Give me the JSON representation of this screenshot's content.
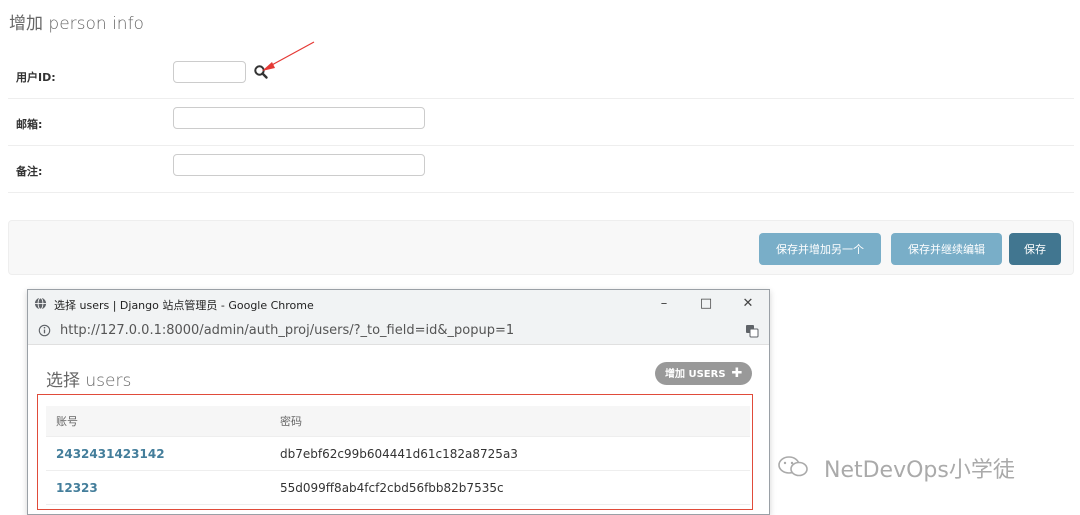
{
  "page": {
    "title": "增加 person info"
  },
  "form": {
    "user_id_label": "用户ID:",
    "email_label": "邮箱:",
    "note_label": "备注:"
  },
  "buttons": {
    "save_add_another": "保存并增加另一个",
    "save_continue": "保存并继续编辑",
    "save": "保存"
  },
  "popup": {
    "window_title": "选择 users | Django 站点管理员 - Google Chrome",
    "url": "http://127.0.0.1:8000/admin/auth_proj/users/?_to_field=id&_popup=1",
    "heading": "选择 users",
    "add_button": "增加 USERS",
    "table": {
      "headers": [
        "账号",
        "密码"
      ],
      "rows": [
        [
          "2432431423142",
          "db7ebf62c99b604441d61c182a8725a3"
        ],
        [
          "12323",
          "55d099ff8ab4fcf2cbd56fbb82b7535c"
        ]
      ]
    }
  },
  "watermark": {
    "text": "NetDevOps小学徒"
  },
  "colors": {
    "primary": "#417690",
    "secondary": "#79aec8",
    "link": "#447e9b",
    "highlight": "#e04b3a"
  },
  "icons": {
    "lookup": "search-icon",
    "window": "globe-icon",
    "address": "info-icon",
    "translate": "translate-icon",
    "add": "plus-icon",
    "watermark": "wechat-icon"
  }
}
